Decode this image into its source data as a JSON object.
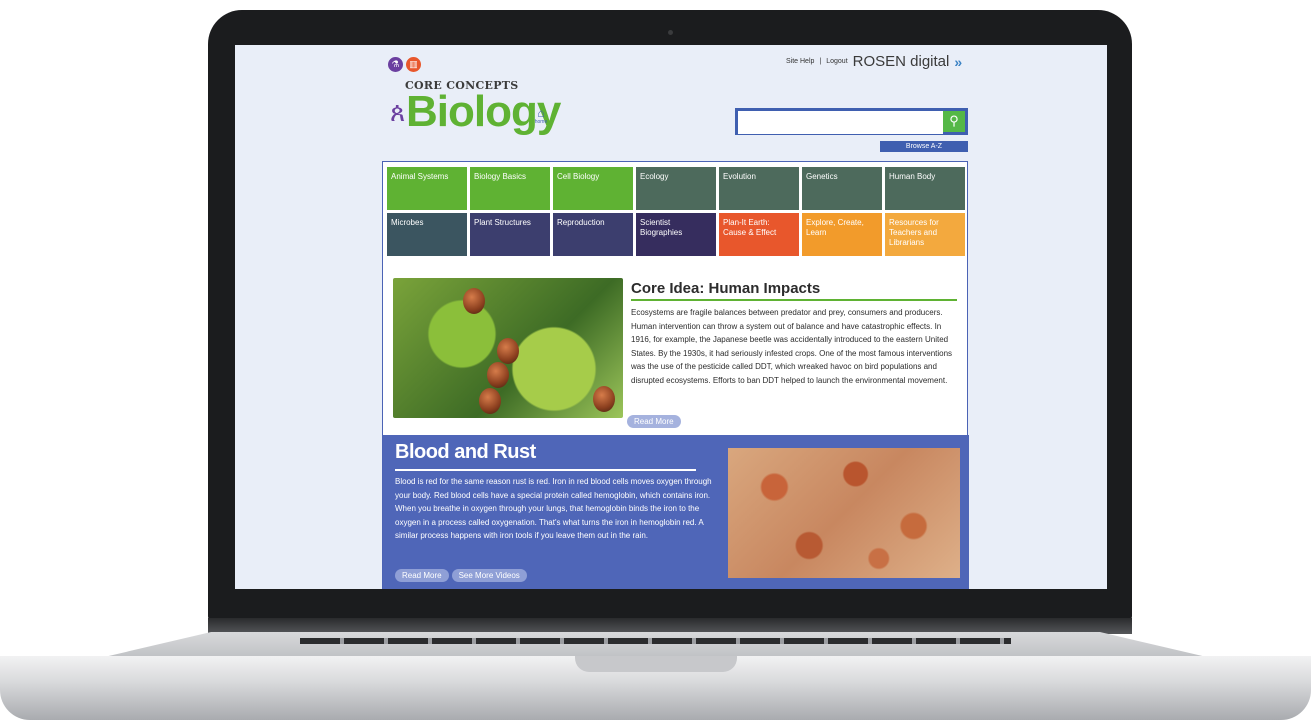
{
  "site": {
    "core_concepts": "CORE CONCEPTS",
    "biology": "Biology",
    "home_label": "home",
    "top_links": {
      "site_help": "Site Help",
      "separator": "|",
      "logout": "Logout",
      "rosen": "ROSEN digital",
      "rosen_arrow": "»"
    },
    "search": {
      "placeholder": "",
      "icon": "search-icon"
    },
    "browse_label": "Browse A-Z"
  },
  "nav_tiles": [
    {
      "label": "Animal Systems",
      "color": "#5fb233"
    },
    {
      "label": "Biology Basics",
      "color": "#5fb233"
    },
    {
      "label": "Cell Biology",
      "color": "#5fb233"
    },
    {
      "label": "Ecology",
      "color": "#4d6a5c"
    },
    {
      "label": "Evolution",
      "color": "#4d6a5c"
    },
    {
      "label": "Genetics",
      "color": "#4d6a5c"
    },
    {
      "label": "Human Body",
      "color": "#4d6a5c"
    },
    {
      "label": "Microbes",
      "color": "#3b5560"
    },
    {
      "label": "Plant Structures",
      "color": "#3c3e6e"
    },
    {
      "label": "Reproduction",
      "color": "#3c3e6e"
    },
    {
      "label": "Scientist Biographies",
      "color": "#362d5e"
    },
    {
      "label": "Plan-It Earth: Cause & Effect",
      "color": "#e8572c"
    },
    {
      "label": "Explore, Create, Learn",
      "color": "#f29b2b"
    },
    {
      "label": "Resources for Teachers and Librarians",
      "color": "#f3a93e"
    }
  ],
  "core_idea": {
    "title": "Core Idea: Human Impacts",
    "text": "Ecosystems are fragile balances between predator and prey, consumers and producers. Human intervention can throw a system out of balance and have catastrophic effects. In 1916, for example, the Japanese beetle was accidentally introduced to the eastern United States. By the 1930s, it had seriously infested crops. One of the most famous interventions was the use of the pesticide called DDT, which wreaked havoc on bird populations and disrupted ecosystems. Efforts to ban DDT helped to launch the environmental movement.",
    "read_more": "Read More"
  },
  "blood_rust": {
    "title": "Blood and Rust",
    "text": "Blood is red for the same reason rust is red. Iron in red blood cells moves oxygen through your body. Red blood cells have a special protein called hemoglobin, which contains iron. When you breathe in oxygen through your lungs, that hemoglobin binds the iron to the oxygen in a process called oxygenation. That's what turns the iron in hemoglobin red. A similar process happens with iron tools if you leave them out in the rain.",
    "read_more": "Read More",
    "see_more_videos": "See More Videos"
  },
  "colors": {
    "brand_green": "#5fb233",
    "brand_blue": "#3f5fb0",
    "panel_blue": "#4f66b8"
  }
}
